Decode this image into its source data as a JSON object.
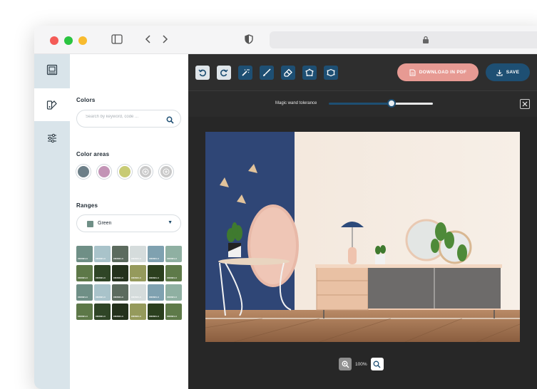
{
  "browser": {},
  "sidebar": {
    "colors_title": "Colors",
    "search_placeholder": "Search by keyword, code ...",
    "color_areas_title": "Color areas",
    "color_areas": [
      {
        "color": "#6d7f88"
      },
      {
        "color": "#c394b6"
      },
      {
        "color": "#c8cb75"
      },
      {
        "add": true
      },
      {
        "add": true
      }
    ],
    "ranges_title": "Ranges",
    "range_selected": "Green",
    "swatches": [
      {
        "color": "#6f8f86",
        "code": "CR2021-3"
      },
      {
        "color": "#a9c3ca",
        "code": "CR2021-3"
      },
      {
        "color": "#5c6b5e",
        "code": "CR2021-3"
      },
      {
        "color": "#d5dcdc",
        "code": "CR2021-3"
      },
      {
        "color": "#7fa1b0",
        "code": "CR2021-3"
      },
      {
        "color": "#8fb0a2",
        "code": "CR2021-3"
      },
      {
        "color": "#5d7848",
        "code": "CR2021-3"
      },
      {
        "color": "#2f4526",
        "code": "CR2021-3"
      },
      {
        "color": "#24311c",
        "code": "CR2021-3"
      },
      {
        "color": "#959a5c",
        "code": "CR2021-3"
      },
      {
        "color": "#2b3f1e",
        "code": "CR2021-3"
      },
      {
        "color": "#5e7a49",
        "code": "CR2021-3"
      },
      {
        "color": "#6f8f86",
        "code": "CR2021-3"
      },
      {
        "color": "#a9c3ca",
        "code": "CR2021-3"
      },
      {
        "color": "#5c6b5e",
        "code": "CR2021-3"
      },
      {
        "color": "#d5dcdc",
        "code": "CR2021-3"
      },
      {
        "color": "#7fa1b0",
        "code": "CR2021-3"
      },
      {
        "color": "#8fb0a2",
        "code": "CR2021-3"
      },
      {
        "color": "#5d7848",
        "code": "CR2021-3"
      },
      {
        "color": "#2f4526",
        "code": "CR2021-3"
      },
      {
        "color": "#24311c",
        "code": "CR2021-3"
      },
      {
        "color": "#959a5c",
        "code": "CR2021-3"
      },
      {
        "color": "#2b3f1e",
        "code": "CR2021-3"
      },
      {
        "color": "#5e7a49",
        "code": "CR2021-3"
      }
    ]
  },
  "toolbar": {
    "download_label": "DOWNLOAD IN PDF",
    "save_label": "SAVE"
  },
  "tolerance": {
    "label": "Magic wand tolerance",
    "value_fraction": 0.6
  },
  "zoom": {
    "value": "100%"
  },
  "colors": {
    "accent": "#1e4f73",
    "pdf_button": "#e79a93",
    "editor_bg": "#272727"
  }
}
